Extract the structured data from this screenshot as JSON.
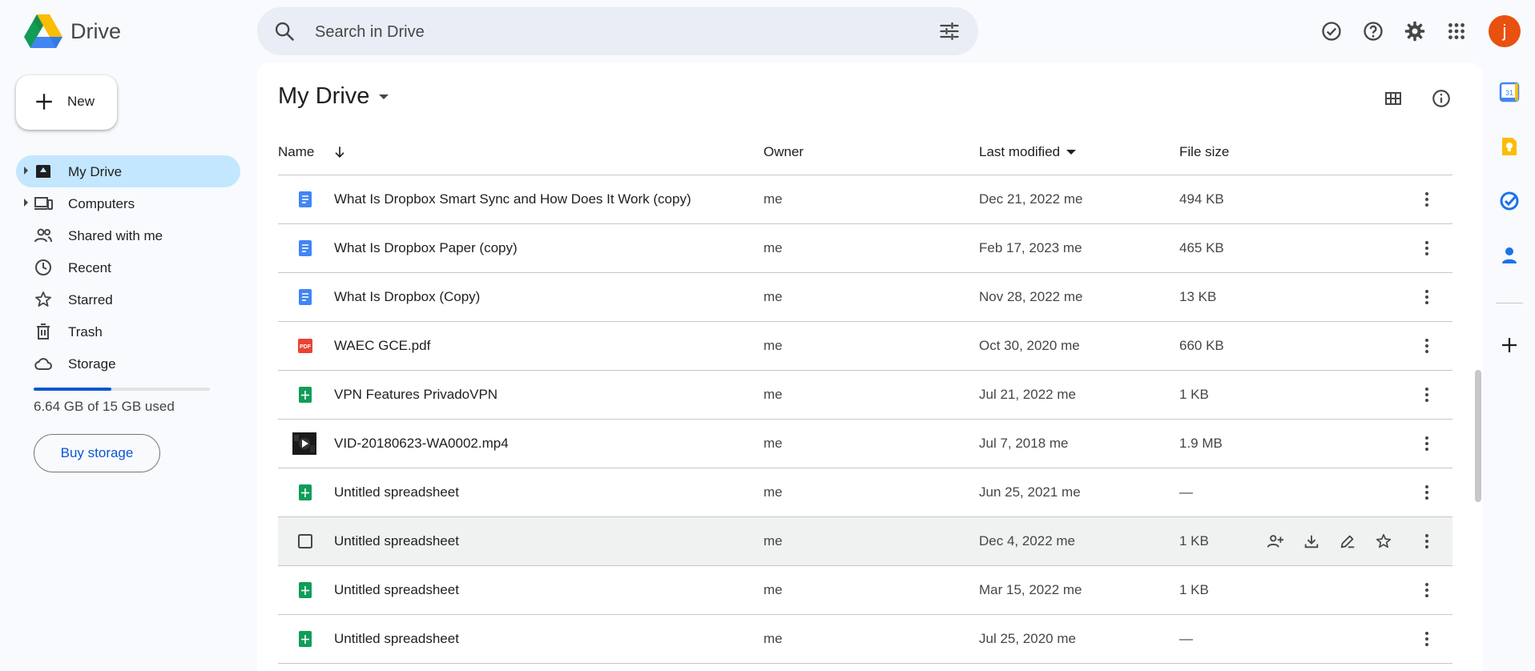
{
  "app": {
    "name": "Drive",
    "colors": {
      "accent": "#0b57d0",
      "active_nav": "#c2e7ff",
      "avatar": "#e8510f"
    }
  },
  "search": {
    "placeholder": "Search in Drive",
    "value": ""
  },
  "header": {
    "icons": [
      "ready-for-offline-icon",
      "help-icon",
      "settings-icon",
      "apps-grid-icon"
    ],
    "avatar_letter": "j"
  },
  "sidebar": {
    "new_label": "New",
    "items": [
      {
        "label": "My Drive",
        "icon": "my-drive-icon",
        "active": true
      },
      {
        "label": "Computers",
        "icon": "computers-icon"
      },
      {
        "label": "Shared with me",
        "icon": "shared-icon"
      },
      {
        "label": "Recent",
        "icon": "clock-icon"
      },
      {
        "label": "Starred",
        "icon": "star-icon"
      },
      {
        "label": "Trash",
        "icon": "trash-icon"
      },
      {
        "label": "Storage",
        "icon": "cloud-icon"
      }
    ],
    "storage_used_fraction": 0.443,
    "storage_text": "6.64 GB of 15 GB used",
    "buy_label": "Buy storage"
  },
  "main": {
    "title": "My Drive",
    "columns": {
      "name": "Name",
      "owner": "Owner",
      "modified": "Last modified",
      "size": "File size"
    },
    "rows": [
      {
        "type": "doc",
        "name": "What Is Dropbox Smart Sync and How Does It Work (copy)",
        "owner": "me",
        "modified": "Dec 21, 2022 me",
        "size": "494 KB"
      },
      {
        "type": "doc",
        "name": "What Is Dropbox Paper (copy)",
        "owner": "me",
        "modified": "Feb 17, 2023 me",
        "size": "465 KB"
      },
      {
        "type": "doc",
        "name": "What Is Dropbox (Copy)",
        "owner": "me",
        "modified": "Nov 28, 2022 me",
        "size": "13 KB"
      },
      {
        "type": "pdf",
        "name": "WAEC GCE.pdf",
        "owner": "me",
        "modified": "Oct 30, 2020 me",
        "size": "660 KB"
      },
      {
        "type": "sheet",
        "name": "VPN Features PrivadoVPN",
        "owner": "me",
        "modified": "Jul 21, 2022 me",
        "size": "1 KB"
      },
      {
        "type": "video",
        "name": "VID-20180623-WA0002.mp4",
        "owner": "me",
        "modified": "Jul 7, 2018 me",
        "size": "1.9 MB"
      },
      {
        "type": "sheet",
        "name": "Untitled spreadsheet",
        "owner": "me",
        "modified": "Jun 25, 2021 me",
        "size": "—"
      },
      {
        "type": "checkbox",
        "name": "Untitled spreadsheet",
        "owner": "me",
        "modified": "Dec 4, 2022 me",
        "size": "1 KB",
        "hover": true
      },
      {
        "type": "sheet",
        "name": "Untitled spreadsheet",
        "owner": "me",
        "modified": "Mar 15, 2022 me",
        "size": "1 KB"
      },
      {
        "type": "sheet",
        "name": "Untitled spreadsheet",
        "owner": "me",
        "modified": "Jul 25, 2020 me",
        "size": "—"
      }
    ],
    "pdf_badge": "PDF"
  }
}
